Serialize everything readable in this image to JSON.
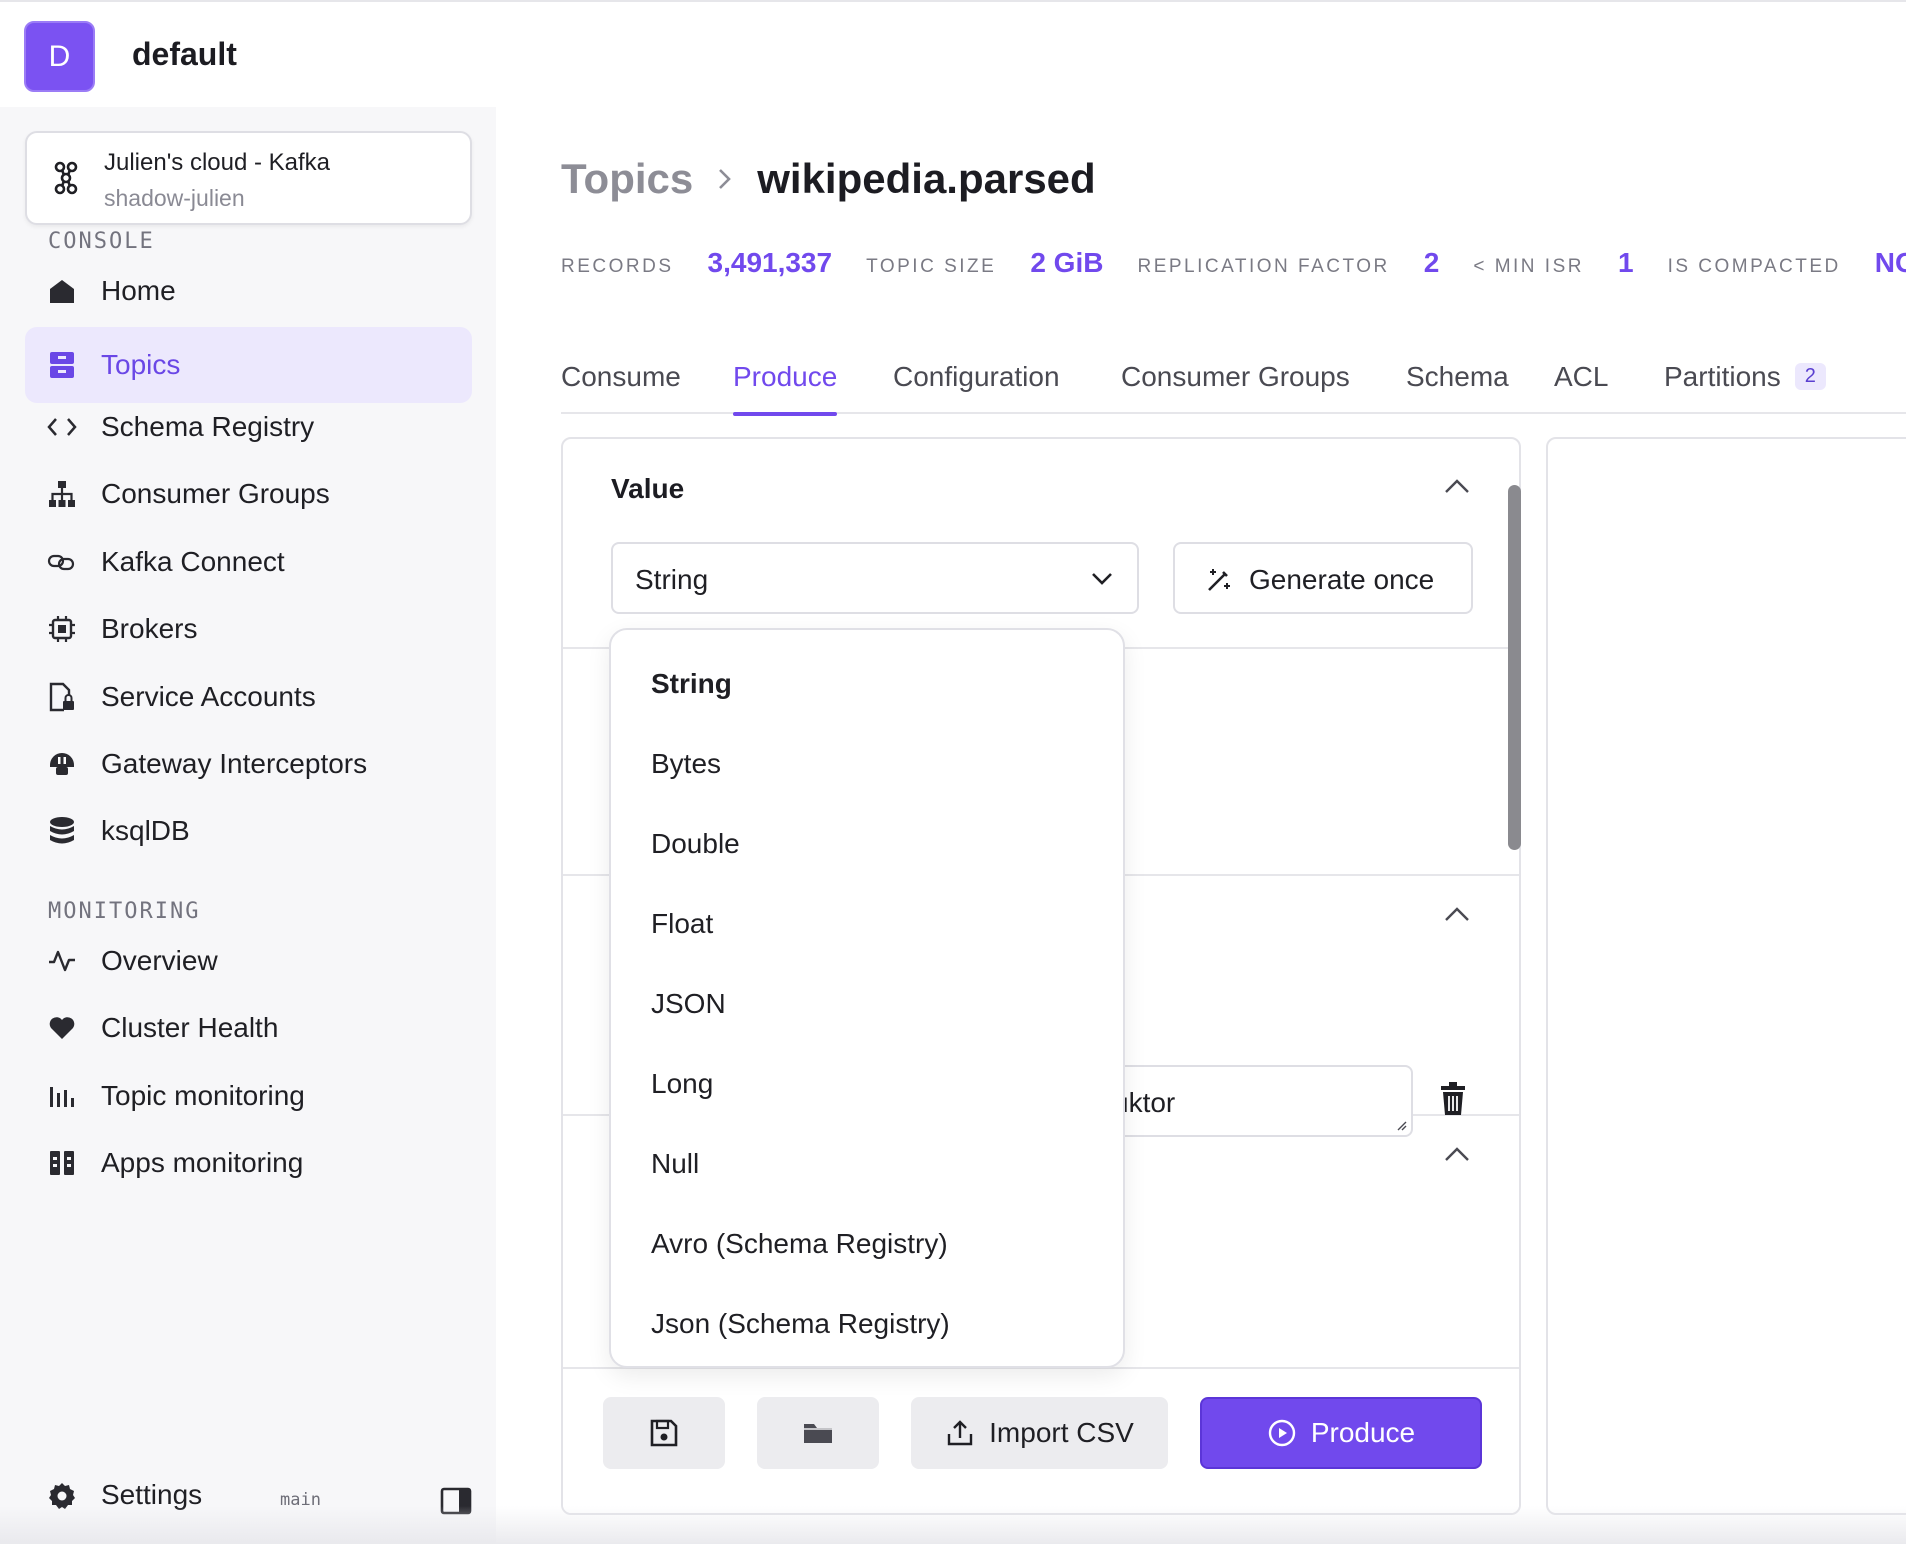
{
  "org": {
    "initial": "D",
    "name": "default"
  },
  "cluster": {
    "name": "Julien's cloud - Kafka",
    "sub": "shadow-julien"
  },
  "sidebar": {
    "console_label": "CONSOLE",
    "console_items": [
      {
        "label": "Home",
        "icon": "home-icon"
      },
      {
        "label": "Topics",
        "icon": "topics-icon",
        "active": true
      },
      {
        "label": "Schema Registry",
        "icon": "code-icon"
      },
      {
        "label": "Consumer Groups",
        "icon": "hierarchy-icon"
      },
      {
        "label": "Kafka Connect",
        "icon": "link-icon"
      },
      {
        "label": "Brokers",
        "icon": "chip-icon"
      },
      {
        "label": "Service Accounts",
        "icon": "file-lock-icon"
      },
      {
        "label": "Gateway Interceptors",
        "icon": "plug-icon"
      },
      {
        "label": "ksqlDB",
        "icon": "database-icon"
      }
    ],
    "monitoring_label": "MONITORING",
    "monitoring_items": [
      {
        "label": "Overview",
        "icon": "activity-icon"
      },
      {
        "label": "Cluster Health",
        "icon": "heart-icon"
      },
      {
        "label": "Topic monitoring",
        "icon": "bar-chart-icon"
      },
      {
        "label": "Apps monitoring",
        "icon": "grid-icon"
      }
    ],
    "settings_label": "Settings",
    "branch": "main"
  },
  "breadcrumb": {
    "root": "Topics",
    "current": "wikipedia.parsed"
  },
  "stats": [
    {
      "label": "RECORDS",
      "value": "3,491,337"
    },
    {
      "label": "TOPIC SIZE",
      "value": "2 GiB"
    },
    {
      "label": "REPLICATION FACTOR",
      "value": "2"
    },
    {
      "label": "< MIN ISR",
      "value": "1"
    },
    {
      "label": "IS COMPACTED",
      "value": "NO"
    }
  ],
  "tabs": [
    {
      "label": "Consume"
    },
    {
      "label": "Produce",
      "active": true
    },
    {
      "label": "Configuration"
    },
    {
      "label": "Consumer Groups"
    },
    {
      "label": "Schema"
    },
    {
      "label": "ACL"
    },
    {
      "label": "Partitions",
      "badge": "2"
    }
  ],
  "value_section": {
    "title": "Value",
    "type_selected": "String",
    "generate_label": "Generate once"
  },
  "header_field_value": "uktor",
  "dropdown_options": [
    "String",
    "Bytes",
    "Double",
    "Float",
    "JSON",
    "Long",
    "Null",
    "Avro (Schema Registry)",
    "Json (Schema Registry)"
  ],
  "footer": {
    "import_label": "Import CSV",
    "produce_label": "Produce"
  },
  "colors": {
    "accent": "#7149ed",
    "active_bg": "#ece8fd"
  }
}
